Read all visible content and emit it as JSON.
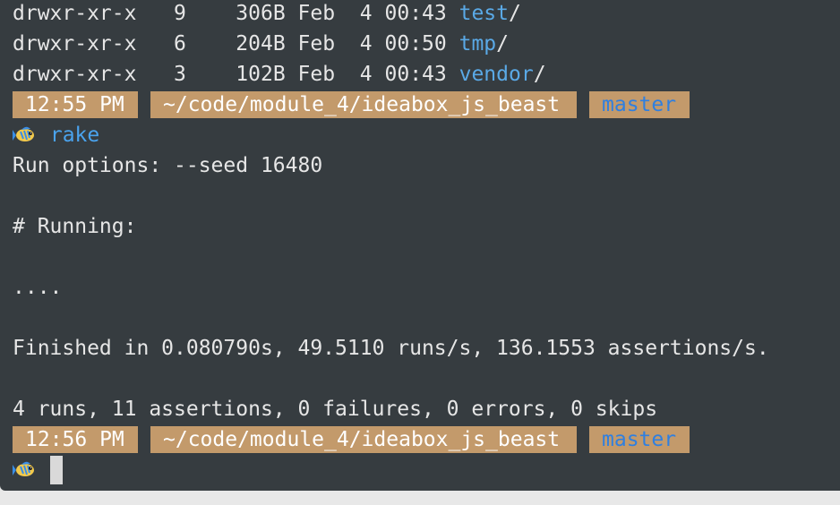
{
  "listing": [
    {
      "perms": "drwxr-xr-x",
      "links": "9",
      "size": "306B",
      "month": "Feb",
      "day": "4",
      "time": "00:43",
      "name": "test",
      "slash": "/"
    },
    {
      "perms": "drwxr-xr-x",
      "links": "6",
      "size": "204B",
      "month": "Feb",
      "day": "4",
      "time": "00:50",
      "name": "tmp",
      "slash": "/"
    },
    {
      "perms": "drwxr-xr-x",
      "links": "3",
      "size": "102B",
      "month": "Feb",
      "day": "4",
      "time": "00:43",
      "name": "vendor",
      "slash": "/"
    }
  ],
  "prompt1": {
    "time": "12:55 PM",
    "path": "~/code/module_4/ideabox_js_beast",
    "branch": "master"
  },
  "command": "rake",
  "output": {
    "run_options": "Run options: --seed 16480",
    "running": "# Running:",
    "dots": "....",
    "finished": "Finished in 0.080790s, 49.5110 runs/s, 136.1553 assertions/s.",
    "summary": "4 runs, 11 assertions, 0 failures, 0 errors, 0 skips"
  },
  "prompt2": {
    "time": "12:56 PM",
    "path": "~/code/module_4/ideabox_js_beast",
    "branch": "master"
  },
  "icons": {
    "prompt_symbol": "fish-icon"
  },
  "colors": {
    "background": "#363c40",
    "segment": "#c39a6b",
    "directory": "#5aa9e6",
    "branch": "#2f7fe0"
  }
}
